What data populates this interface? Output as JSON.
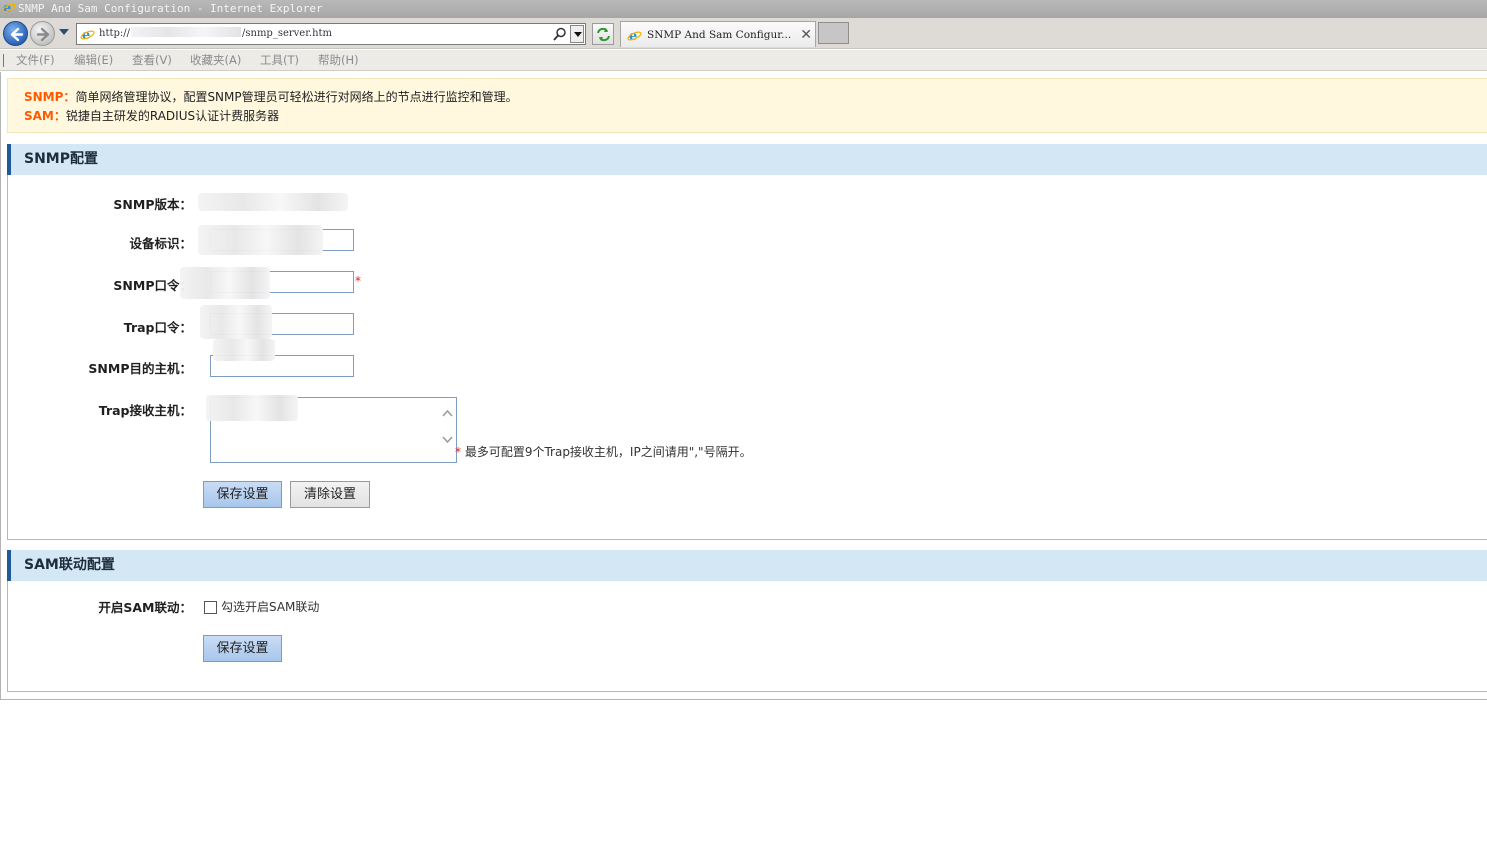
{
  "window": {
    "title": "SNMP And Sam Configuration - Internet Explorer",
    "address": {
      "prefix": "http://",
      "suffix": "/snmp_server.htm"
    },
    "tab_label": "SNMP And Sam Configur...",
    "tab_close": "✕"
  },
  "menu": {
    "items": [
      "文件(F)",
      "编辑(E)",
      "查看(V)",
      "收藏夹(A)",
      "工具(T)",
      "帮助(H)"
    ]
  },
  "notice": {
    "snmp_key": "SNMP：",
    "snmp_text": "简单网络管理协议，配置SNMP管理员可轻松进行对网络上的节点进行监控和管理。",
    "sam_key": "SAM：",
    "sam_text": "锐捷自主研发的RADIUS认证计费服务器"
  },
  "snmp_section": {
    "title": "SNMP配置",
    "version_label": "SNMP版本：",
    "device_id_label": "设备标识：",
    "community_label": "SNMP口令：",
    "community_required": "*",
    "trap_password_label": "Trap口令：",
    "target_host_label": "SNMP目的主机：",
    "trap_hosts_label": "Trap接收主机：",
    "trap_hosts_hint_star": "*",
    "trap_hosts_hint": "最多可配置9个Trap接收主机，IP之间请用\",\"号隔开。",
    "save_label": "保存设置",
    "clear_label": "清除设置"
  },
  "sam_section": {
    "title": "SAM联动配置",
    "enable_label": "开启SAM联动：",
    "checkbox_text": "勾选开启SAM联动",
    "checkbox_checked": false,
    "save_label": "保存设置"
  },
  "colors": {
    "notice_key": "#ff5a00",
    "section_accent": "#1c5b98",
    "section_bg": "#d4e7f5",
    "notice_bg": "#fff8df",
    "required": "#e02020"
  },
  "icons": [
    "ie-icon",
    "back-arrow-icon",
    "forward-arrow-icon",
    "dropdown-icon",
    "search-icon",
    "refresh-icon",
    "close-icon",
    "scroll-up-icon",
    "scroll-down-icon"
  ]
}
